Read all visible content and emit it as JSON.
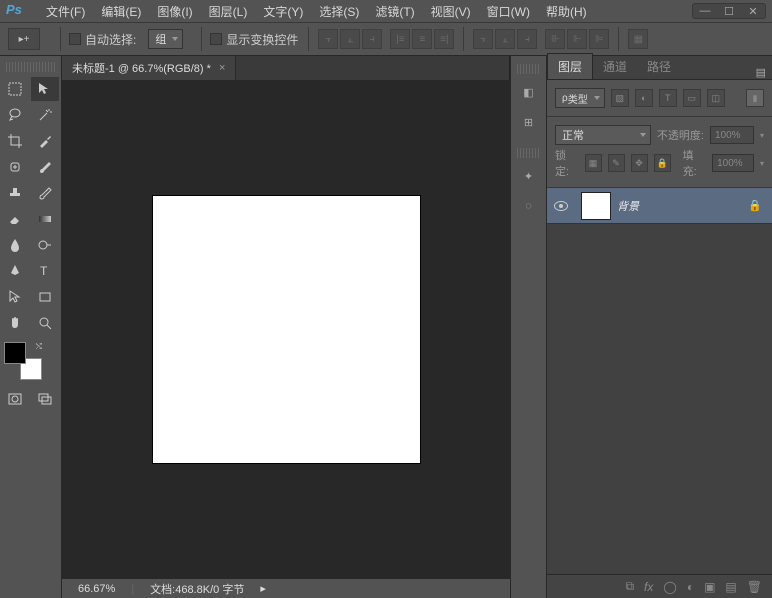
{
  "app": {
    "logo": "Ps"
  },
  "menu": {
    "file": "文件(F)",
    "edit": "编辑(E)",
    "image": "图像(I)",
    "layer": "图层(L)",
    "type": "文字(Y)",
    "select": "选择(S)",
    "filter": "滤镜(T)",
    "view": "视图(V)",
    "window": "窗口(W)",
    "help": "帮助(H)"
  },
  "options": {
    "auto_select": "自动选择:",
    "auto_select_target": "组",
    "show_transform": "显示变换控件"
  },
  "document": {
    "tab_title": "未标题-1 @ 66.7%(RGB/8) *",
    "zoom": "66.67%",
    "doc_info": "文档:468.8K/0 字节"
  },
  "panels": {
    "tabs": {
      "layers": "图层",
      "channels": "通道",
      "paths": "路径"
    },
    "filter_label": "类型",
    "blend_mode": "正常",
    "opacity_label": "不透明度:",
    "opacity_value": "100%",
    "lock_label": "锁定:",
    "fill_label": "填充:",
    "fill_value": "100%",
    "layers_list": [
      {
        "name": "背景",
        "locked": true
      }
    ]
  }
}
